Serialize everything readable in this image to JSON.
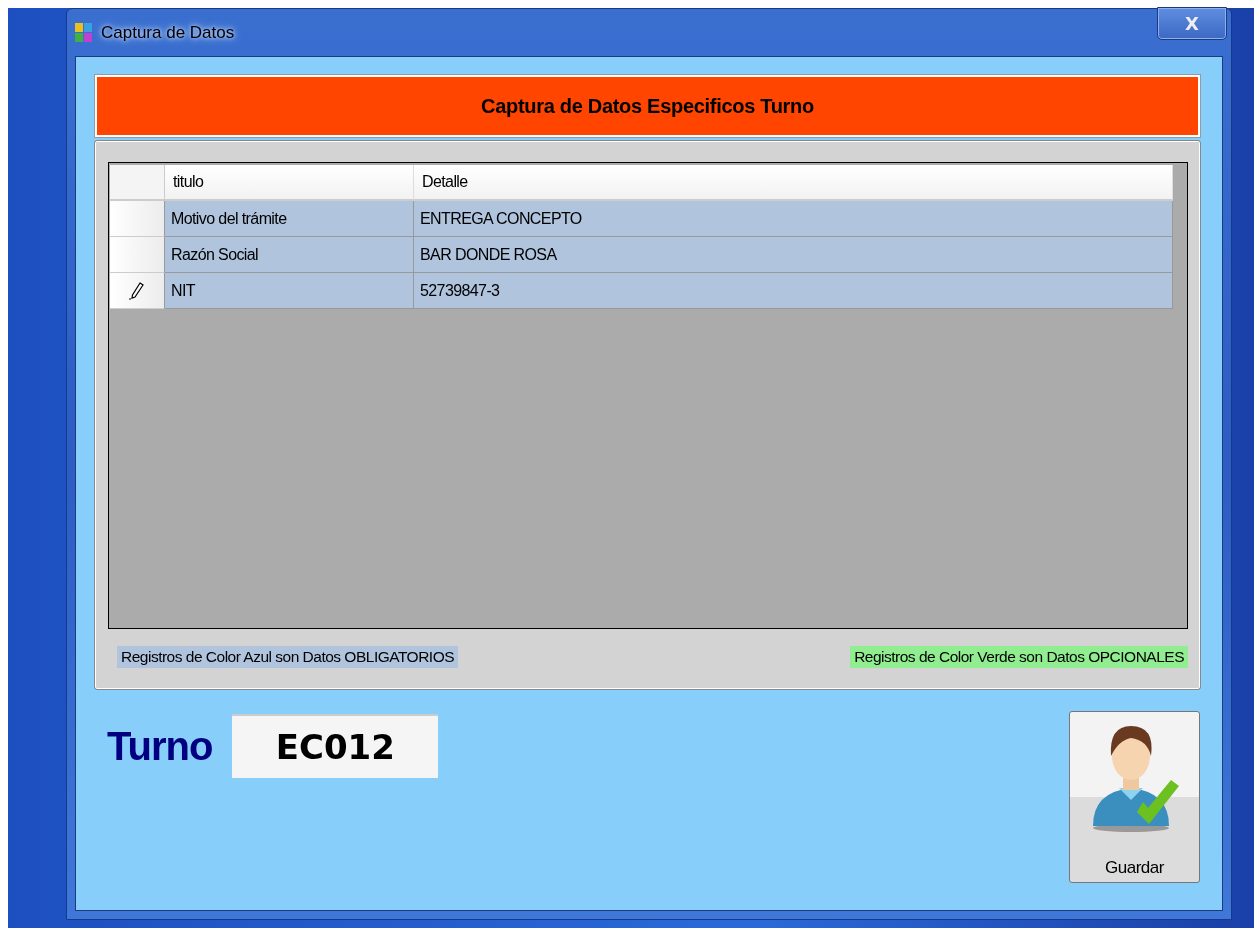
{
  "window": {
    "title": "Captura de Datos",
    "close": "X"
  },
  "header": "Captura de Datos Especificos Turno",
  "table": {
    "columns": [
      "titulo",
      "Detalle"
    ],
    "rows": [
      {
        "titulo": "Motivo del trámite",
        "detalle": "ENTREGA CONCEPTO",
        "color": "#b0c4de",
        "editing": false
      },
      {
        "titulo": "Razón Social",
        "detalle": "BAR DONDE ROSA",
        "color": "#b0c4de",
        "editing": false
      },
      {
        "titulo": "NIT",
        "detalle": "52739847-3",
        "color": "#b0c4de",
        "editing": true
      }
    ]
  },
  "legends": [
    {
      "text": "Registros de Color Azul son Datos OBLIGATORIOS",
      "color": "#b0c4de"
    },
    {
      "text": "Registros de Color Verde son Datos OPCIONALES",
      "color": "#90ee90"
    }
  ],
  "turno": {
    "label": "Turno",
    "value": "EC012"
  },
  "save_button": "Guardar"
}
